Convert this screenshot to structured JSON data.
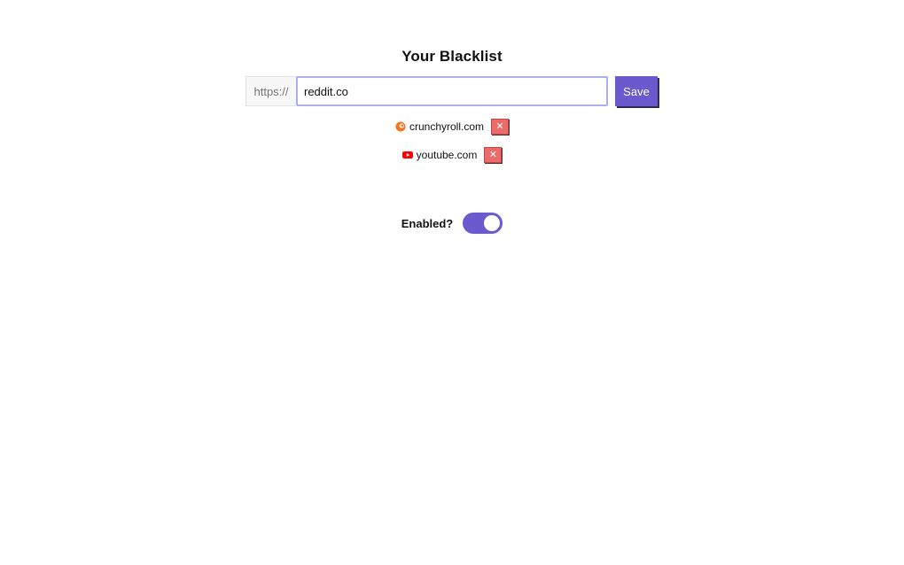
{
  "title": "Your Blacklist",
  "input": {
    "prefix": "https://",
    "value": "reddit.co",
    "save_label": "Save"
  },
  "blacklist": [
    {
      "domain": "crunchyroll.com",
      "icon": "crunchyroll-icon",
      "icon_color": "#f47521",
      "remove_label": "✕"
    },
    {
      "domain": "youtube.com",
      "icon": "youtube-icon",
      "icon_color": "#ff0000",
      "remove_label": "✕"
    }
  ],
  "toggle": {
    "label": "Enabled?",
    "enabled": true
  },
  "colors": {
    "accent": "#6a5acd",
    "remove": "#ec6a6a"
  }
}
